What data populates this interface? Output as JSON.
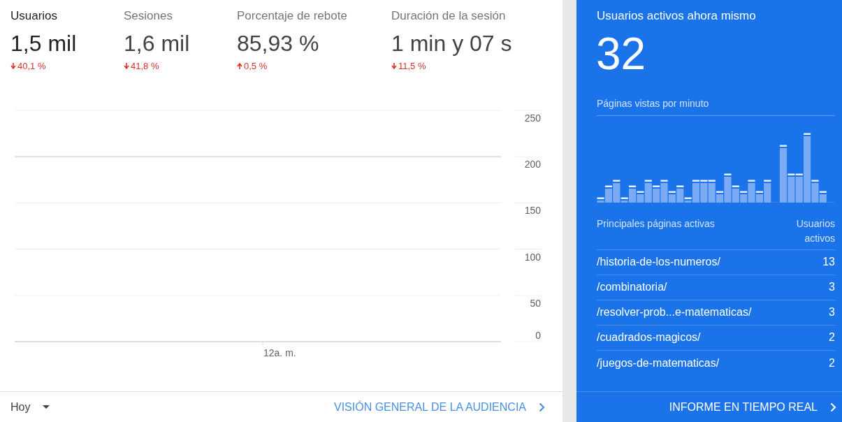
{
  "metrics": [
    {
      "label": "Usuarios",
      "value": "1,5 mil",
      "change": "40,1 %",
      "kind": "down",
      "selected": true
    },
    {
      "label": "Sesiones",
      "value": "1,6 mil",
      "change": "41,8 %",
      "kind": "down",
      "selected": false
    },
    {
      "label": "Porcentaje de rebote",
      "value": "85,93 %",
      "change": "0,5 %",
      "kind": "up",
      "selected": false
    },
    {
      "label": "Duración de la sesión",
      "value": "1 min y 07 s",
      "change": "11,5 %",
      "kind": "down",
      "selected": false
    }
  ],
  "chart": {
    "y_labels": [
      "250",
      "200",
      "150",
      "100",
      "50",
      "0"
    ],
    "x_label": "12a. m."
  },
  "footer": {
    "date_range": "Hoy",
    "link": "VISIÓN GENERAL DE LA AUDIENCIA"
  },
  "realtime": {
    "title": "Usuarios activos ahora mismo",
    "count": "32",
    "pageviews_title": "Páginas vistas por minuto",
    "table": {
      "columns": [
        "Principales páginas activas",
        "Usuarios activos"
      ],
      "rows": [
        {
          "page": "/historia-de-los-numeros/",
          "users": "13"
        },
        {
          "page": "/combinatoria/",
          "users": "3"
        },
        {
          "page": "/resolver-prob...e-matematicas/",
          "users": "3"
        },
        {
          "page": "/cuadrados-magicos/",
          "users": "2"
        },
        {
          "page": "/juegos-de-matematicas/",
          "users": "2"
        }
      ]
    },
    "link": "INFORME EN TIEMPO REAL"
  }
}
